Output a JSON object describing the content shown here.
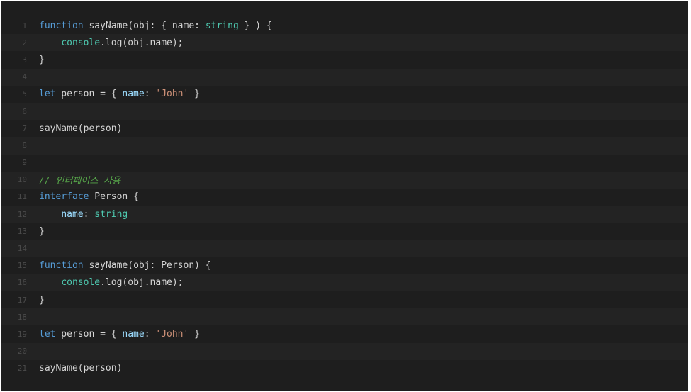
{
  "colors": {
    "background": "#1e1e1e",
    "alt_row": "#232323",
    "line_number": "#4a4a4a",
    "default": "#d4d4d4",
    "keyword": "#569cd6",
    "type": "#4ec9b0",
    "property": "#9cdcfe",
    "string": "#ce9178",
    "comment": "#57a64a"
  },
  "lines": [
    {
      "n": "1",
      "tokens": [
        {
          "t": "function",
          "c": "kw"
        },
        {
          "t": " sayName(obj: { name: ",
          "c": "plain"
        },
        {
          "t": "string",
          "c": "type"
        },
        {
          "t": " } ) {",
          "c": "plain"
        }
      ]
    },
    {
      "n": "2",
      "tokens": [
        {
          "t": "    ",
          "c": "plain"
        },
        {
          "t": "console",
          "c": "type"
        },
        {
          "t": ".log(obj.name);",
          "c": "plain"
        }
      ]
    },
    {
      "n": "3",
      "tokens": [
        {
          "t": "}",
          "c": "plain"
        }
      ]
    },
    {
      "n": "4",
      "tokens": []
    },
    {
      "n": "5",
      "tokens": [
        {
          "t": "let",
          "c": "kw"
        },
        {
          "t": " person = { ",
          "c": "plain"
        },
        {
          "t": "name",
          "c": "prop"
        },
        {
          "t": ": ",
          "c": "plain"
        },
        {
          "t": "'John'",
          "c": "str"
        },
        {
          "t": " }",
          "c": "plain"
        }
      ]
    },
    {
      "n": "6",
      "tokens": []
    },
    {
      "n": "7",
      "tokens": [
        {
          "t": "sayName(person)",
          "c": "plain"
        }
      ]
    },
    {
      "n": "8",
      "tokens": []
    },
    {
      "n": "9",
      "tokens": []
    },
    {
      "n": "10",
      "tokens": [
        {
          "t": "// 인터페이스 사용",
          "c": "com"
        }
      ]
    },
    {
      "n": "11",
      "tokens": [
        {
          "t": "interface",
          "c": "kw"
        },
        {
          "t": " Person {",
          "c": "plain"
        }
      ]
    },
    {
      "n": "12",
      "tokens": [
        {
          "t": "    ",
          "c": "plain"
        },
        {
          "t": "name",
          "c": "prop"
        },
        {
          "t": ": ",
          "c": "plain"
        },
        {
          "t": "string",
          "c": "type"
        }
      ]
    },
    {
      "n": "13",
      "tokens": [
        {
          "t": "}",
          "c": "plain"
        }
      ]
    },
    {
      "n": "14",
      "tokens": []
    },
    {
      "n": "15",
      "tokens": [
        {
          "t": "function",
          "c": "kw"
        },
        {
          "t": " sayName(obj: Person) {",
          "c": "plain"
        }
      ]
    },
    {
      "n": "16",
      "tokens": [
        {
          "t": "    ",
          "c": "plain"
        },
        {
          "t": "console",
          "c": "type"
        },
        {
          "t": ".log(obj.name);",
          "c": "plain"
        }
      ]
    },
    {
      "n": "17",
      "tokens": [
        {
          "t": "}",
          "c": "plain"
        }
      ]
    },
    {
      "n": "18",
      "tokens": []
    },
    {
      "n": "19",
      "tokens": [
        {
          "t": "let",
          "c": "kw"
        },
        {
          "t": " person = { ",
          "c": "plain"
        },
        {
          "t": "name",
          "c": "prop"
        },
        {
          "t": ": ",
          "c": "plain"
        },
        {
          "t": "'John'",
          "c": "str"
        },
        {
          "t": " }",
          "c": "plain"
        }
      ]
    },
    {
      "n": "20",
      "tokens": []
    },
    {
      "n": "21",
      "tokens": [
        {
          "t": "sayName(person)",
          "c": "plain"
        }
      ]
    }
  ]
}
